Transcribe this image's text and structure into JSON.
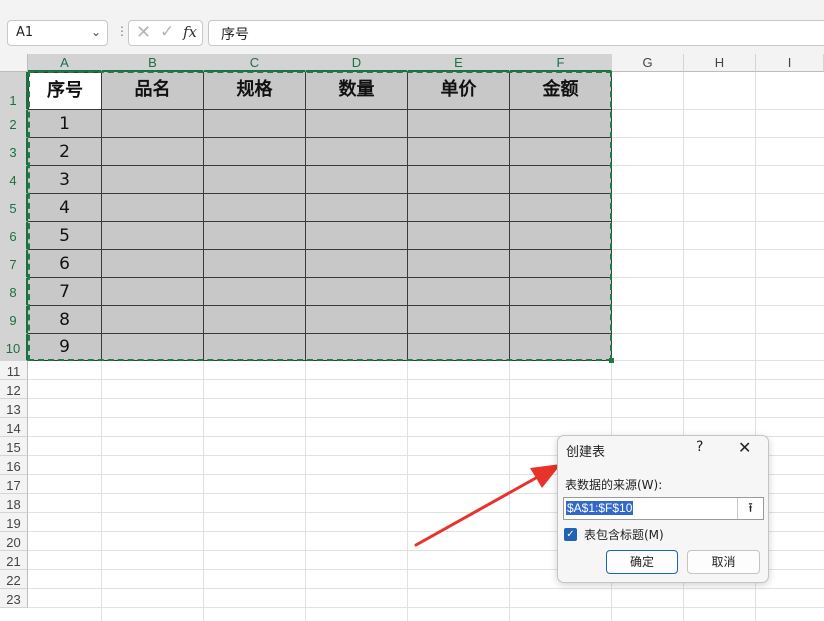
{
  "formula_bar": {
    "name_box": "A1",
    "function_icon": "fx",
    "formula_value": "序号"
  },
  "columns": [
    "A",
    "B",
    "C",
    "D",
    "E",
    "F",
    "G",
    "H",
    "I"
  ],
  "rows": [
    "1",
    "2",
    "3",
    "4",
    "5",
    "6",
    "7",
    "8",
    "9",
    "10",
    "11",
    "12",
    "13",
    "14",
    "15",
    "16",
    "17",
    "18",
    "19",
    "20",
    "21",
    "22",
    "23"
  ],
  "table": {
    "headers": [
      "序号",
      "品名",
      "规格",
      "数量",
      "单价",
      "金额"
    ],
    "serials": [
      "1",
      "2",
      "3",
      "4",
      "5",
      "6",
      "7",
      "8",
      "9"
    ]
  },
  "dialog": {
    "title": "创建表",
    "help": "?",
    "close": "✕",
    "source_label": "表数据的来源(W):",
    "range_value": "$A$1:$F$10",
    "has_headers_label": "表包含标题(M)",
    "has_headers_checked": true,
    "ok_label": "确定",
    "cancel_label": "取消"
  },
  "colors": {
    "accent": "#1f7a45",
    "arrow": "#e8322a",
    "table_fill": "#c8c8c8"
  }
}
